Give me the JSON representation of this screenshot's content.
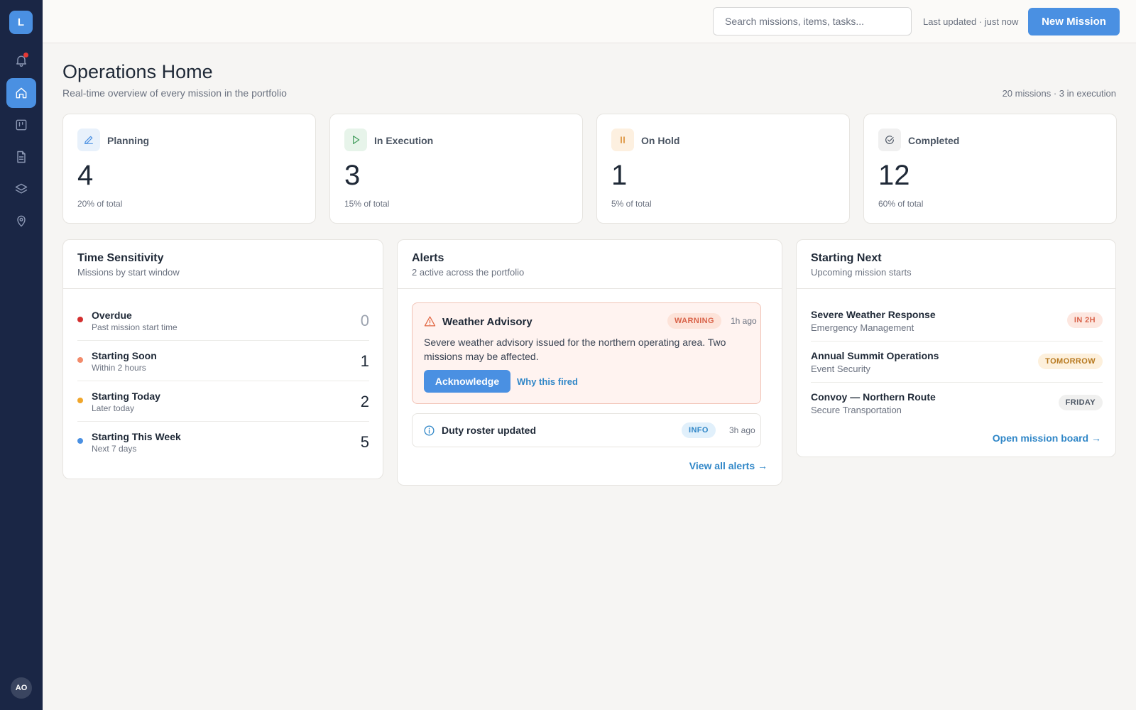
{
  "sidebar": {
    "logo": "L",
    "nav": [
      {
        "icon": "bell-icon",
        "active": false,
        "has_notification": true
      },
      {
        "icon": "home-icon",
        "active": true
      },
      {
        "icon": "kanban-icon",
        "active": false
      },
      {
        "icon": "document-icon",
        "active": false
      },
      {
        "icon": "layers-icon",
        "active": false
      },
      {
        "icon": "map-pin-icon",
        "active": false
      }
    ],
    "user_initials": "AO"
  },
  "topbar": {
    "search_placeholder": "Search missions, items, tasks...",
    "last_updated": "Last updated · just now",
    "new_mission_label": "New Mission"
  },
  "header": {
    "title": "Operations Home",
    "subtitle": "Real-time overview of every mission in the portfolio",
    "counts": "20 missions · 3 in execution"
  },
  "stats": [
    {
      "label": "Planning",
      "value": "4",
      "pct": "20% of total",
      "icon": "pencil-icon",
      "color": "#4a90e2",
      "bg": "#e8f1fb"
    },
    {
      "label": "In Execution",
      "value": "3",
      "pct": "15% of total",
      "icon": "play-icon",
      "color": "#3f9b5a",
      "bg": "#e7f4ea"
    },
    {
      "label": "On Hold",
      "value": "1",
      "pct": "5% of total",
      "icon": "pause-icon",
      "color": "#d9892b",
      "bg": "#fdf0e0"
    },
    {
      "label": "Completed",
      "value": "12",
      "pct": "60% of total",
      "icon": "check-circle-icon",
      "color": "#4b5563",
      "bg": "#f0f0f0"
    }
  ],
  "time_sensitivity": {
    "title": "Time Sensitivity",
    "subtitle": "Missions by start window",
    "rows": [
      {
        "label": "Overdue",
        "desc": "Past mission start time",
        "count": "0",
        "color": "#d32f2f"
      },
      {
        "label": "Starting Soon",
        "desc": "Within 2 hours",
        "count": "1",
        "color": "#f28b6b"
      },
      {
        "label": "Starting Today",
        "desc": "Later today",
        "count": "2",
        "color": "#f0a62b"
      },
      {
        "label": "Starting This Week",
        "desc": "Next 7 days",
        "count": "5",
        "color": "#4a90e2"
      }
    ]
  },
  "alerts": {
    "title": "Alerts",
    "subtitle": "2 active across the portfolio",
    "warning": {
      "title": "Weather Advisory",
      "badge": "WARNING",
      "time": "1h ago",
      "body": "Severe weather advisory issued for the northern operating area. Two missions may be affected.",
      "primary_action": "Acknowledge",
      "secondary_action": "Why this fired",
      "color": "#e0643f"
    },
    "info": {
      "title": "Duty roster updated",
      "badge": "INFO",
      "time": "3h ago",
      "color": "#2f86c7"
    },
    "view_all": "View all alerts →"
  },
  "starting_next": {
    "title": "Starting Next",
    "subtitle": "Upcoming mission starts",
    "items": [
      {
        "name": "Severe Weather Response",
        "org": "Emergency Management",
        "badge": "IN 2H",
        "badge_color": "#d9634a",
        "badge_bg": "#fde7e0"
      },
      {
        "name": "Annual Summit Operations",
        "org": "Event Security",
        "badge": "TOMORROW",
        "badge_color": "#b7791f",
        "badge_bg": "#fdf0dc"
      },
      {
        "name": "Convoy — Northern Route",
        "org": "Secure Transportation",
        "badge": "FRIDAY",
        "badge_color": "#4b5563",
        "badge_bg": "#f0f0ef"
      }
    ],
    "open_board": "Open mission board →"
  }
}
